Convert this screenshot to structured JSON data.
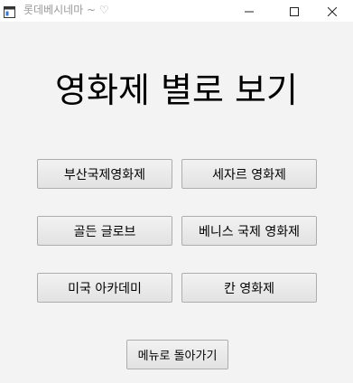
{
  "window": {
    "title": "롯데베시네마 ~ ♡",
    "controls": {
      "minimize": "minimize-icon",
      "maximize": "maximize-icon",
      "close": "close-icon"
    }
  },
  "main": {
    "heading": "영화제 별로 보기",
    "festivals": [
      "부산국제영화제",
      "세자르 영화제",
      "골든 글로브",
      "베니스 국제 영화제",
      "미국 아카데미",
      "칸 영화제"
    ],
    "back_label": "메뉴로 돌아가기"
  }
}
